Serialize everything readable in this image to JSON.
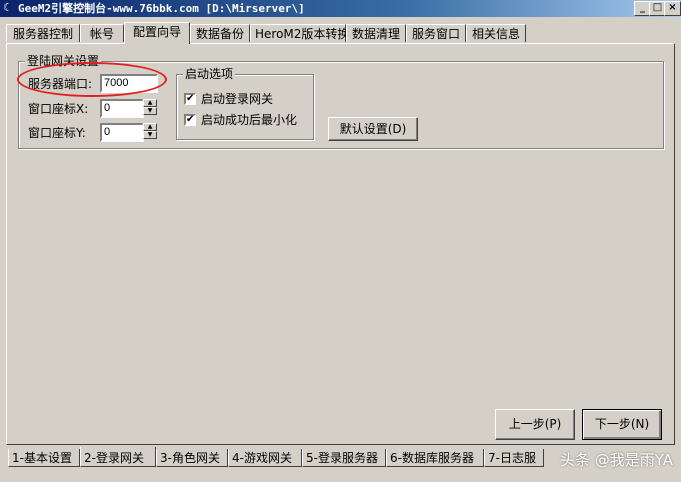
{
  "window": {
    "title": "GeeM2引擎控制台-www.76bbk.com [D:\\Mirserver\\]",
    "minimize": "_",
    "maximize": "□",
    "close": "×"
  },
  "top_tabs": [
    "服务器控制",
    "帐号",
    "配置向导",
    "数据备份",
    "HeroM2版本转换",
    "数据清理",
    "服务窗口",
    "相关信息"
  ],
  "login_gateway_group": {
    "title": "登陆网关设置",
    "port_label": "服务器端口:",
    "port_value": "7000",
    "window_x_label": "窗口座标X:",
    "window_x_value": "0",
    "window_y_label": "窗口座标Y:",
    "window_y_value": "0"
  },
  "startup_group": {
    "title": "启动选项",
    "options": [
      {
        "label": "启动登录网关",
        "checked": true
      },
      {
        "label": "启动成功后最小化",
        "checked": true
      }
    ]
  },
  "default_button": "默认设置(D)",
  "nav": {
    "prev": "上一步(P)",
    "next": "下一步(N)"
  },
  "bottom_tabs": [
    "1-基本设置",
    "2-登录网关",
    "3-角色网关",
    "4-游戏网关",
    "5-登录服务器",
    "6-数据库服务器",
    "7-日志服"
  ],
  "watermark": "头条 @我是雨YA"
}
